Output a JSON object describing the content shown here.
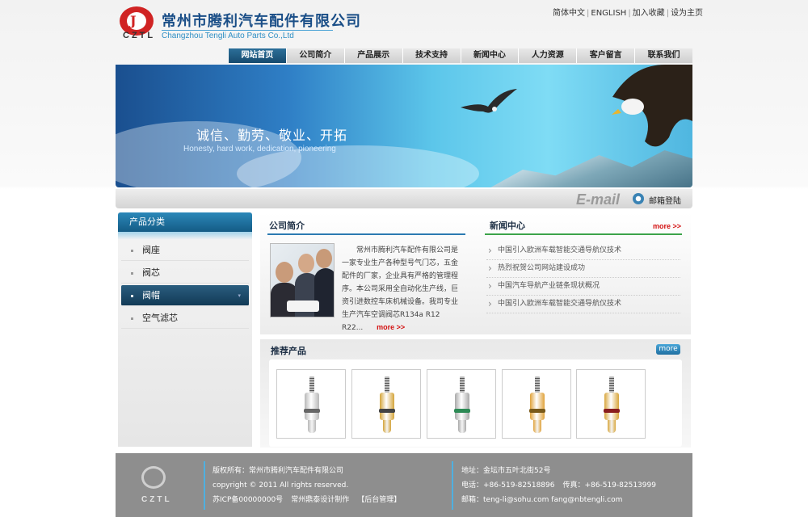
{
  "header": {
    "logo_abbr": "CZTL",
    "company_cn": "常州市腾利汽车配件有限公司",
    "company_en": "Changzhou Tengli Auto Parts Co.,Ltd",
    "top_links": [
      "简体中文",
      "ENGLISH",
      "加入收藏",
      "设为主页"
    ],
    "separator": "|"
  },
  "nav": {
    "items": [
      "网站首页",
      "公司简介",
      "产品展示",
      "技术支持",
      "新闻中心",
      "人力资源",
      "客户留言",
      "联系我们"
    ],
    "active_index": 0
  },
  "banner": {
    "slogan_cn": "诚信、勤劳、敬业、开拓",
    "slogan_en": "Honesty, hard work, dedication, pioneering"
  },
  "email": {
    "word": "E-mail",
    "login_label": "邮箱登陆"
  },
  "sidebar": {
    "title": "产品分类",
    "items": [
      "阀座",
      "阀芯",
      "阀帽",
      "空气滤芯"
    ],
    "active_index": 2,
    "active_caret": "▾"
  },
  "about": {
    "title": "公司简介",
    "text": "常州市腾利汽车配件有限公司是一家专业生产各种型号气门芯，五金配件的厂家，企业具有严格的管理程序。本公司采用全自动化生产线，巨资引进数控车床机械设备。我司专业生产汽车空调阀芯R134a R12 R22...",
    "more": "more >>"
  },
  "news": {
    "title": "新闻中心",
    "more": "more >>",
    "items": [
      "中国引入欧洲车载智能交通导航仪技术",
      "热烈祝贺公司网站建设成功",
      "中国汽车导航产业链条现状概况",
      "中国引入欧洲车载智能交通导航仪技术"
    ]
  },
  "recommended": {
    "title": "推荐产品",
    "more": "more",
    "products": [
      {
        "name": "valve-core-silver-1",
        "color": "#b8b8b8",
        "band": "#666666"
      },
      {
        "name": "valve-core-brass-1",
        "color": "#d4a43a",
        "band": "#444444"
      },
      {
        "name": "valve-core-green-seal",
        "color": "#a9a9a9",
        "band": "#2d8a55"
      },
      {
        "name": "valve-core-brass-spring",
        "color": "#e0a23a",
        "band": "#7a5a1a"
      },
      {
        "name": "valve-core-brass-red",
        "color": "#d8a63c",
        "band": "#8a1e1e"
      }
    ]
  },
  "footer": {
    "logo_abbr": "CZTL",
    "copyright_owner": "版权所有：常州市腾利汽车配件有限公司",
    "copyright": "copyright © 2011   All rights reserved.",
    "icp": "苏ICP备00000000号",
    "designer": "常州鼎泰设计制作",
    "admin": "【后台管理】",
    "address": "地址：金坛市五叶北街52号",
    "phone": "电话：+86-519-82518896",
    "fax": "传真：+86-519-82513999",
    "email": "邮箱：teng-li@sohu.com  fang@nbtengli.com"
  },
  "colors": {
    "brand_red": "#d02323",
    "nav_active": "#1b5779",
    "more_red": "#d31111",
    "footer_bg": "#8e8e8e"
  }
}
